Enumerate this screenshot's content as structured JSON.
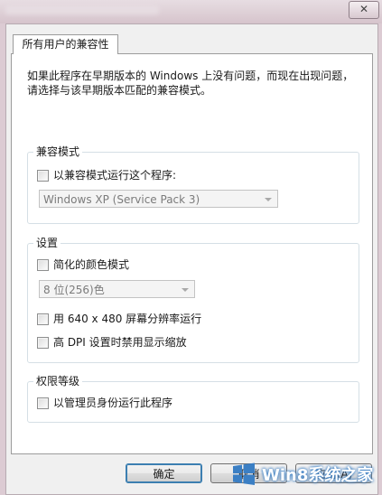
{
  "window": {
    "close_glyph": "✕"
  },
  "tab": {
    "label": "所有用户的兼容性"
  },
  "description": "如果此程序在早期版本的 Windows 上没有问题，而现在出现问题，请选择与该早期版本匹配的兼容模式。",
  "compat_mode": {
    "title": "兼容模式",
    "checkbox_label": "以兼容模式运行这个程序:",
    "checked": false,
    "select_value": "Windows XP (Service Pack 3)"
  },
  "settings": {
    "title": "设置",
    "reduced_color": {
      "label": "简化的颜色模式",
      "checked": false
    },
    "color_select_value": "8 位(256)色",
    "res_640": {
      "label": "用 640 x 480 屏幕分辨率运行",
      "checked": false
    },
    "high_dpi": {
      "label": "高 DPI 设置时禁用显示缩放",
      "checked": false
    }
  },
  "privilege": {
    "title": "权限等级",
    "run_as_admin": {
      "label": "以管理员身份运行此程序",
      "checked": false
    }
  },
  "buttons": {
    "ok": "确定",
    "cancel": "取消",
    "apply": "应用(A)"
  },
  "watermark": {
    "text": "Win8系统之家",
    "icon": "windows-logo-icon",
    "color": "#3b7fc4"
  }
}
